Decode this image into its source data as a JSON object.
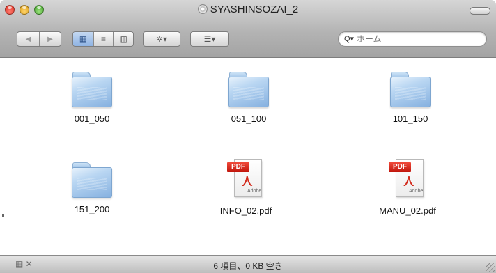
{
  "window": {
    "title": "SYASHINSOZAI_2"
  },
  "toolbar": {
    "back_glyph": "◀",
    "forward_glyph": "▶",
    "view_icon_glyph": "▦",
    "view_list_glyph": "≡",
    "view_column_glyph": "▥",
    "action_glyph": "✲▾",
    "arrange_glyph": "☰▾"
  },
  "search": {
    "icon_glyph": "Q▾",
    "placeholder": "ホーム"
  },
  "items": [
    {
      "name": "001_050",
      "kind": "folder"
    },
    {
      "name": "051_100",
      "kind": "folder"
    },
    {
      "name": "101_150",
      "kind": "folder"
    },
    {
      "name": "151_200",
      "kind": "folder"
    },
    {
      "name": "INFO_02.pdf",
      "kind": "pdf"
    },
    {
      "name": "MANU_02.pdf",
      "kind": "pdf"
    }
  ],
  "pdf_icon": {
    "badge": "PDF",
    "brand": "Adobe",
    "logo_glyph": "⋏"
  },
  "statusbar": {
    "text": "6 項目、0 KB 空き",
    "icons_glyph": "▦ ✕"
  },
  "colors": {
    "accent": "#8fb3e3",
    "folder": "#86b1e0",
    "pdf_red": "#d22a1c"
  }
}
